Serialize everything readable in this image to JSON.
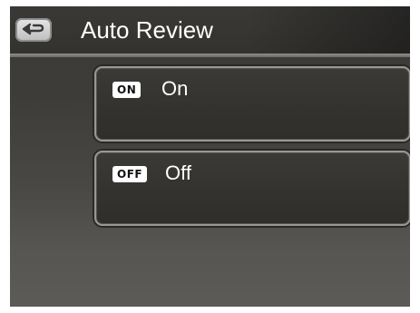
{
  "header": {
    "title": "Auto Review",
    "back_icon": "back-arrow-icon"
  },
  "options": [
    {
      "badge": "ON",
      "label": "On"
    },
    {
      "badge": "OFF",
      "label": "Off"
    }
  ],
  "colors": {
    "text": "#ffffff",
    "badge_bg": "#ffffff",
    "badge_text": "#111111",
    "panel_border": "#9a9893"
  }
}
